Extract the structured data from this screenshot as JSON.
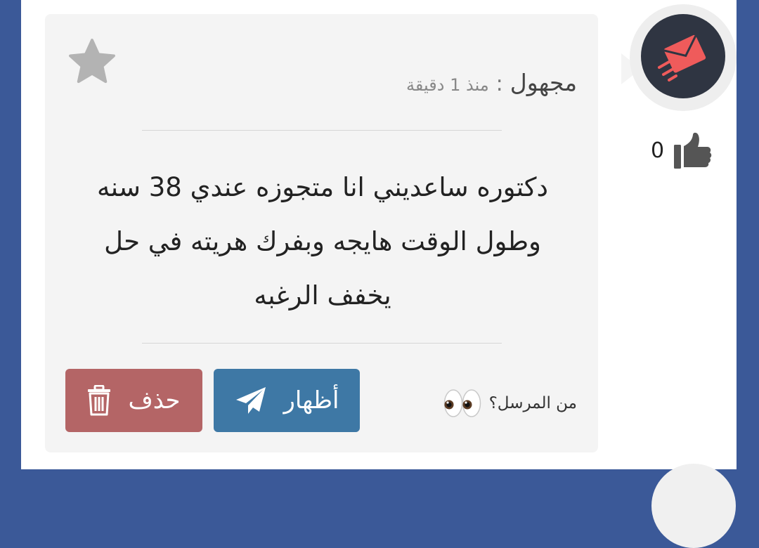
{
  "message": {
    "author": "مجهول",
    "separator": ":",
    "time": "منذ 1 دقيقة",
    "text": "دكتوره ساعديني انا متجوزه عندي 38 سنه وطول الوقت هايجه وبفرك هريته في حل يخفف الرغبه"
  },
  "sender_prompt": {
    "label": "من المرسل؟",
    "icon": "eyes-emoji"
  },
  "buttons": {
    "reveal": "أظهار",
    "delete": "حذف"
  },
  "likes": {
    "count": "0"
  },
  "colors": {
    "outer_background": "#3b5998",
    "card_background": "#f4f4f4",
    "reveal_button": "#3e78a5",
    "delete_button": "#b46566",
    "avatar_background": "#2f3542",
    "avatar_envelope": "#ef5b5b"
  }
}
